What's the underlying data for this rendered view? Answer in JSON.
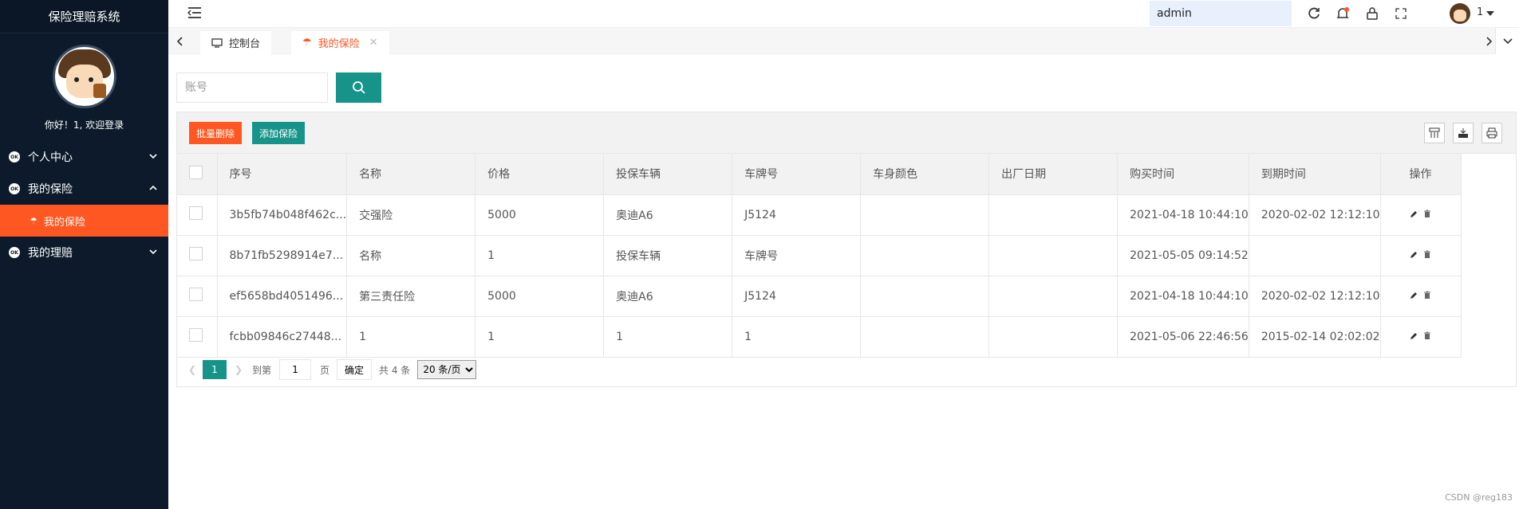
{
  "app": {
    "title": "保险理赔系统",
    "greeting": "你好！1, 欢迎登录"
  },
  "sidebar": {
    "items": [
      {
        "label": "个人中心",
        "icon": "ok-circle-icon",
        "expanded": false
      },
      {
        "label": "我的保险",
        "icon": "ok-circle-icon",
        "expanded": true,
        "children": [
          {
            "label": "我的保险",
            "icon": "umbrella-icon",
            "active": true
          }
        ]
      },
      {
        "label": "我的理赔",
        "icon": "ok-circle-icon",
        "expanded": false
      }
    ]
  },
  "header": {
    "admin_value": "admin",
    "user_name": "1"
  },
  "tabs": [
    {
      "label": "控制台",
      "icon": "monitor-icon",
      "active": false
    },
    {
      "label": "我的保险",
      "icon": "umbrella-icon",
      "active": true
    }
  ],
  "search": {
    "placeholder": "账号"
  },
  "toolbar": {
    "batch_delete": "批量删除",
    "add": "添加保险"
  },
  "table": {
    "columns": [
      "序号",
      "名称",
      "价格",
      "投保车辆",
      "车牌号",
      "车身颜色",
      "出厂日期",
      "购买时间",
      "到期时间",
      "操作"
    ],
    "rows": [
      {
        "id": "3b5fb74b048f462c...",
        "name": "交强险",
        "price": "5000",
        "vehicle": "奥迪A6",
        "plate": "J5124",
        "color": "",
        "factory_date": "",
        "buy_time": "2021-04-18 10:44:10",
        "expire_time": "2020-02-02 12:12:10"
      },
      {
        "id": "8b71fb5298914e7...",
        "name": "名称",
        "price": "1",
        "vehicle": "投保车辆",
        "plate": "车牌号",
        "color": "",
        "factory_date": "",
        "buy_time": "2021-05-05 09:14:52",
        "expire_time": ""
      },
      {
        "id": "ef5658bd4051496...",
        "name": "第三责任险",
        "price": "5000",
        "vehicle": "奥迪A6",
        "plate": "J5124",
        "color": "",
        "factory_date": "",
        "buy_time": "2021-04-18 10:44:10",
        "expire_time": "2020-02-02 12:12:10"
      },
      {
        "id": "fcbb09846c27448...",
        "name": "1",
        "price": "1",
        "vehicle": "1",
        "plate": "1",
        "color": "",
        "factory_date": "",
        "buy_time": "2021-05-06 22:46:56",
        "expire_time": "2015-02-14 02:02:02"
      }
    ]
  },
  "pager": {
    "current": "1",
    "goto_label": "到第",
    "page_input": "1",
    "page_unit": "页",
    "confirm": "确定",
    "total": "共 4 条",
    "per_page": "20 条/页"
  },
  "watermark": "CSDN @reg183",
  "colors": {
    "sidebar_bg": "#0c1a2b",
    "accent_orange": "#ff5722",
    "accent_teal": "#16948a"
  }
}
